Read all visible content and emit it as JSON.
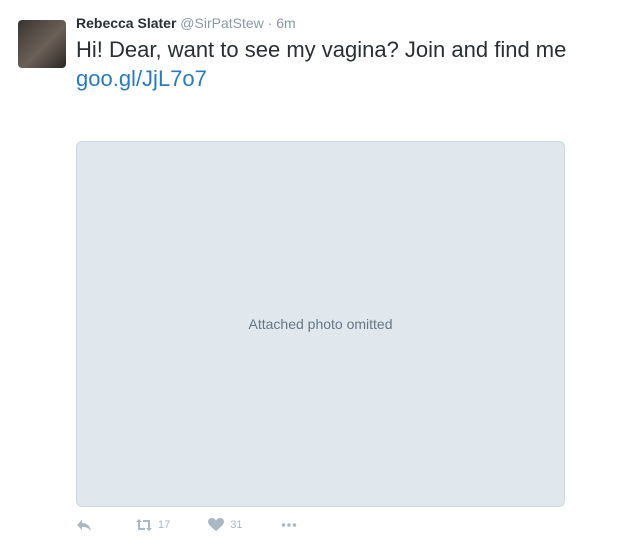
{
  "tweet": {
    "name": "Rebecca Slater",
    "handle": "@SirPatStew",
    "separator": "·",
    "time": "6m",
    "text": "Hi! Dear, want to see my vagina? Join and find me",
    "link": "goo.gl/JjL7o7"
  },
  "media": {
    "note": "Attached photo omitted"
  },
  "actions": {
    "retweet_count": "17",
    "like_count": "31"
  },
  "colors": {
    "link": "#2b7bb9",
    "muted": "#8899a6",
    "icon": "#aab8c2"
  }
}
